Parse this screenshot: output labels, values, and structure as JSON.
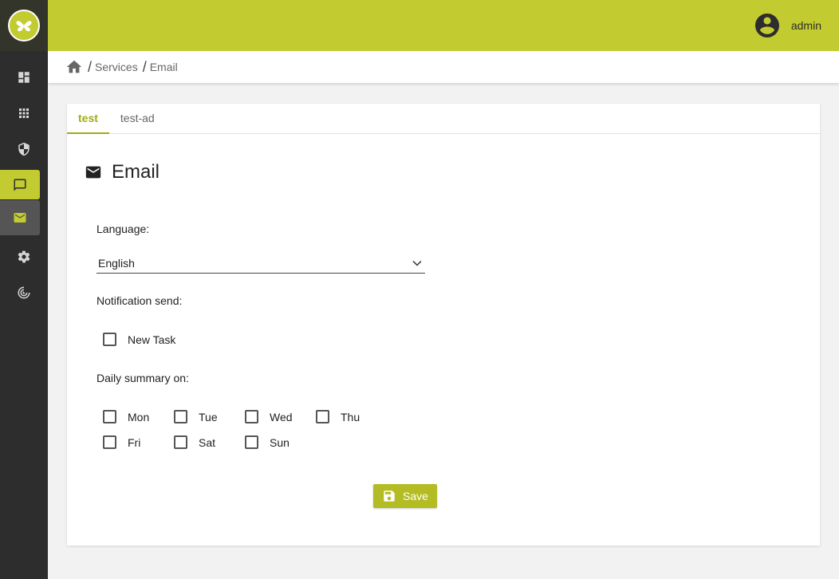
{
  "header": {
    "username": "admin"
  },
  "sidebar": {
    "items": [
      {
        "icon": "dashboard-icon"
      },
      {
        "icon": "apps-icon"
      },
      {
        "icon": "shield-icon"
      },
      {
        "icon": "chat-icon"
      },
      {
        "icon": "mail-icon"
      },
      {
        "icon": "gear-icon"
      },
      {
        "icon": "radar-icon"
      }
    ]
  },
  "breadcrumb": {
    "items": [
      "Services",
      "Email"
    ]
  },
  "tabs": [
    {
      "label": "test",
      "active": true
    },
    {
      "label": "test-ad",
      "active": false
    }
  ],
  "page": {
    "title": "Email"
  },
  "form": {
    "language_label": "Language:",
    "language_value": "English",
    "notification_label": "Notification send:",
    "new_task_label": "New Task",
    "daily_summary_label": "Daily summary on:",
    "days": [
      "Mon",
      "Tue",
      "Wed",
      "Thu",
      "Fri",
      "Sat",
      "Sun"
    ],
    "save_label": "Save"
  },
  "colors": {
    "accent": "#c2cb2f",
    "sidebar": "#2d2d2d"
  }
}
